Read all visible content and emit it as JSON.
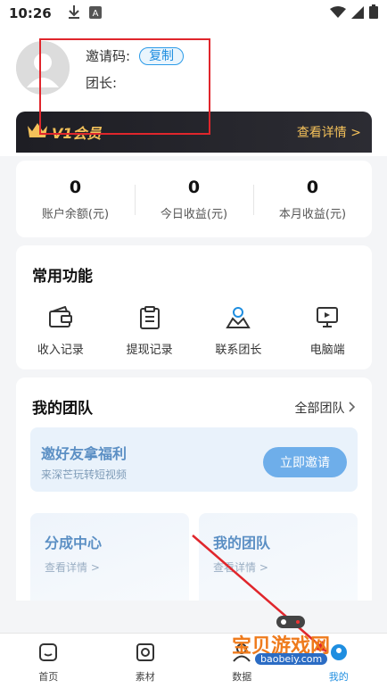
{
  "status_bar": {
    "time": "10:26"
  },
  "profile": {
    "invite_code_label": "邀请码:",
    "copy_label": "复制",
    "leader_label": "团长:"
  },
  "vip": {
    "level": "V1会员",
    "detail": "查看详情 >"
  },
  "stats": [
    {
      "value": "0",
      "label": "账户余额(元)"
    },
    {
      "value": "0",
      "label": "今日收益(元)"
    },
    {
      "value": "0",
      "label": "本月收益(元)"
    }
  ],
  "functions": {
    "title": "常用功能",
    "items": [
      {
        "label": "收入记录",
        "icon": "wallet-icon"
      },
      {
        "label": "提现记录",
        "icon": "clipboard-icon"
      },
      {
        "label": "联系团长",
        "icon": "contact-icon"
      },
      {
        "label": "电脑端",
        "icon": "monitor-icon"
      }
    ]
  },
  "team": {
    "title": "我的团队",
    "all_label": "全部团队",
    "banner_title": "邀好友拿福利",
    "banner_sub": "来深芒玩转短视频",
    "invite_button": "立即邀请",
    "share_center": "分成中心",
    "share_link": "查看详情 >",
    "my_team": "我的团队",
    "my_team_link": "查看详情 >"
  },
  "bottom_nav": [
    {
      "label": "首页",
      "icon": "home-icon"
    },
    {
      "label": "素材",
      "icon": "material-icon"
    },
    {
      "label": "数据",
      "icon": "data-icon"
    },
    {
      "label": "我的",
      "icon": "profile-icon"
    }
  ],
  "watermark": {
    "text": "宝贝游戏网",
    "url": "baobeiy.com"
  },
  "colors": {
    "accent": "#1f8ee0",
    "vip_gold": "#f4c15a",
    "annotation": "#e0262c"
  }
}
